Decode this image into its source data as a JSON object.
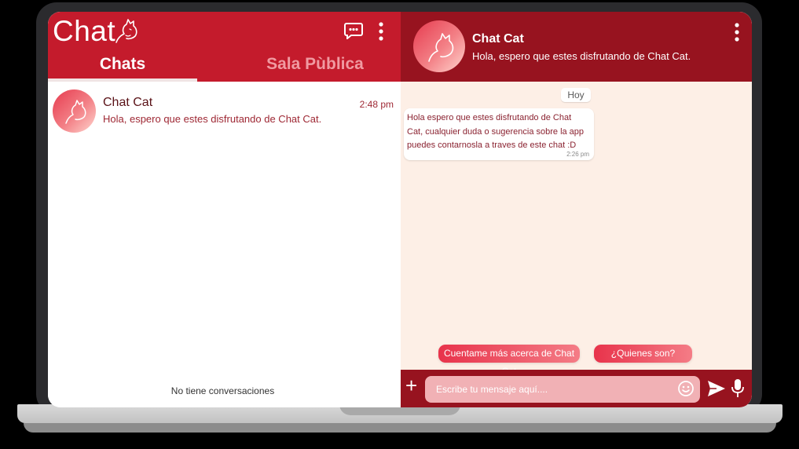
{
  "app": {
    "title": "Chat",
    "logo": "cat-head-outline-icon",
    "header_icons": [
      "new-chat-icon",
      "more-vert-icon"
    ]
  },
  "tabs": [
    {
      "label": "Chats",
      "active": true
    },
    {
      "label": "Sala Pùblica",
      "active": false
    }
  ],
  "conversations": [
    {
      "name": "Chat Cat",
      "preview": "Hola, espero que estes disfrutando de Chat Cat.",
      "time": "2:48 pm"
    }
  ],
  "empty_note": "No tiene conversaciones",
  "active_chat": {
    "name": "Chat Cat",
    "status": "Hola, espero que estes disfrutando de Chat Cat.",
    "date_chip": "Hoy",
    "messages": [
      {
        "text": "Hola espero que estes disfrutando de Chat Cat, cualquier duda o sugerencia sobre la app puedes contarnosla a traves de este chat :D",
        "time": "2:26 pm"
      }
    ],
    "suggestions": [
      "Cuentame más acerca de Chat Cat",
      "¿Quienes son?"
    ],
    "input_placeholder": "Escribe tu mensaje aquí....",
    "input_icons": [
      "plus-icon",
      "emoji-icon",
      "send-icon",
      "mic-icon"
    ]
  },
  "colors": {
    "left_header": "#c41b2c",
    "right_header": "#97131f",
    "chat_background": "#fdefe6",
    "suggestion_gradient": [
      "#e8334b",
      "#f47c86"
    ]
  }
}
